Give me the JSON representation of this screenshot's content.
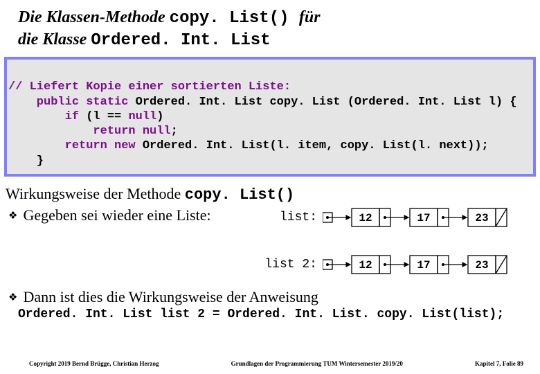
{
  "title": {
    "part1": "Die Klassen-Methode ",
    "mono1": "copy. List() ",
    "part2": "für",
    "part3": "die Klasse ",
    "mono2": "Ordered. Int. List"
  },
  "code": {
    "l1": "// Liefert Kopie einer sortierten Liste:",
    "l2a": "    public static ",
    "l2b": "Ordered. Int. List copy. List (Ordered. Int. List l) {",
    "l3a": "        if ",
    "l3b": "(l == ",
    "l3c": "null",
    "l3d": ")",
    "l4a": "            return null",
    "l4b": ";",
    "l5a": "        return new ",
    "l5b": "Ordered. Int. List(l. item, copy. List(l. next));",
    "l6": "    }"
  },
  "section": {
    "heading_a": "Wirkungsweise der Methode ",
    "heading_b": "copy. List()",
    "bullet1": "Gegeben sei wieder eine Liste:",
    "bullet2": "Dann ist dies die Wirkungsweise der Anweisung",
    "assign": "Ordered. Int. List list 2 = Ordered. Int. List. copy. List(list);"
  },
  "lists": {
    "label1": "list:",
    "label2": "list 2:",
    "nodes": [
      "12",
      "17",
      "23"
    ]
  },
  "footer": {
    "left": "Copyright 2019 Bernd Brügge, Christian Herzog",
    "center": "Grundlagen der Programmierung TUM Wintersemester 2019/20",
    "right": "Kapitel 7, Folie 89"
  }
}
